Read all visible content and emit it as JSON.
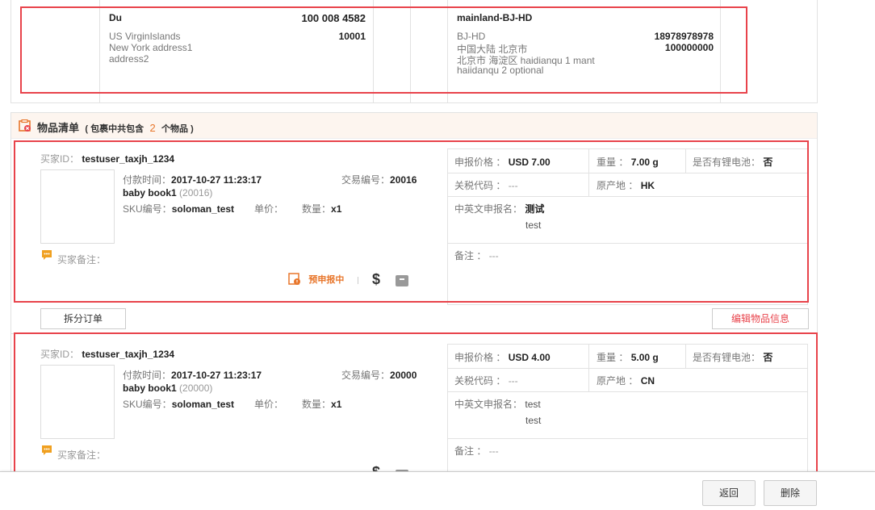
{
  "addresses": {
    "sender": {
      "name": "Du",
      "phone": "100 008 4582",
      "line1": "US VirginIslands",
      "zip": "10001",
      "line2": "New York address1",
      "line3": "address2"
    },
    "receiver": {
      "name": "mainland-BJ-HD",
      "line1": "BJ-HD",
      "phone": "18978978978",
      "line2": "中国大陆 北京市",
      "zip": "100000000",
      "line3": "北京市 海淀区 haidianqu 1 mant",
      "line4": "haiidanqu 2 optional"
    }
  },
  "items_section": {
    "title": "物品清单",
    "count_prefix": "( 包裹中共包含",
    "count": "2",
    "count_suffix": "个物品 )"
  },
  "items": [
    {
      "buyer_label": "买家ID：",
      "buyer_id": "testuser_taxjh_1234",
      "pay_time_label": "付款时间：",
      "pay_time": "2017-10-27 11:23:17",
      "trade_label": "交易编号：",
      "trade_no": "20016",
      "name": "baby book1",
      "name_code": "(20016)",
      "sku_label": "SKU编号：",
      "sku": "soloman_test",
      "price_label": "单价：",
      "qty_label": "数量：",
      "qty": "x1",
      "remark_label": "买家备注：",
      "declare_label": "预申报中",
      "declared_price_label": "申报价格 ：",
      "declared_price": "USD 7.00",
      "weight_label": "重量 ：",
      "weight": "7.00 g",
      "battery_label": "是否有锂电池：",
      "battery": "否",
      "hs_label": "关税代码 ：",
      "hs_code": "---",
      "origin_label": "原产地 ：",
      "origin": "HK",
      "cn_en_name_label": "中英文申报名：",
      "cn_name": "测试",
      "en_name": "test",
      "note_label": "备注 ：",
      "note": "---"
    },
    {
      "buyer_label": "买家ID：",
      "buyer_id": "testuser_taxjh_1234",
      "pay_time_label": "付款时间：",
      "pay_time": "2017-10-27 11:23:17",
      "trade_label": "交易编号：",
      "trade_no": "20000",
      "name": "baby book1",
      "name_code": "(20000)",
      "sku_label": "SKU编号：",
      "sku": "soloman_test",
      "price_label": "单价：",
      "qty_label": "数量：",
      "qty": "x1",
      "remark_label": "买家备注：",
      "declared_price_label": "申报价格 ：",
      "declared_price": "USD 4.00",
      "weight_label": "重量 ：",
      "weight": "5.00 g",
      "battery_label": "是否有锂电池：",
      "battery": "否",
      "hs_label": "关税代码 ：",
      "hs_code": "---",
      "origin_label": "原产地 ：",
      "origin": "CN",
      "cn_en_name_label": "中英文申报名：",
      "cn_name": "test",
      "en_name": "test",
      "note_label": "备注 ：",
      "note": "---"
    }
  ],
  "actions": {
    "split_order": "拆分订单",
    "edit_item_info": "编辑物品信息",
    "back": "返回",
    "delete": "删除"
  },
  "colors": {
    "highlight_red": "#e8434b",
    "accent_orange": "#e8762b",
    "header_bg": "#fdf5ef"
  }
}
